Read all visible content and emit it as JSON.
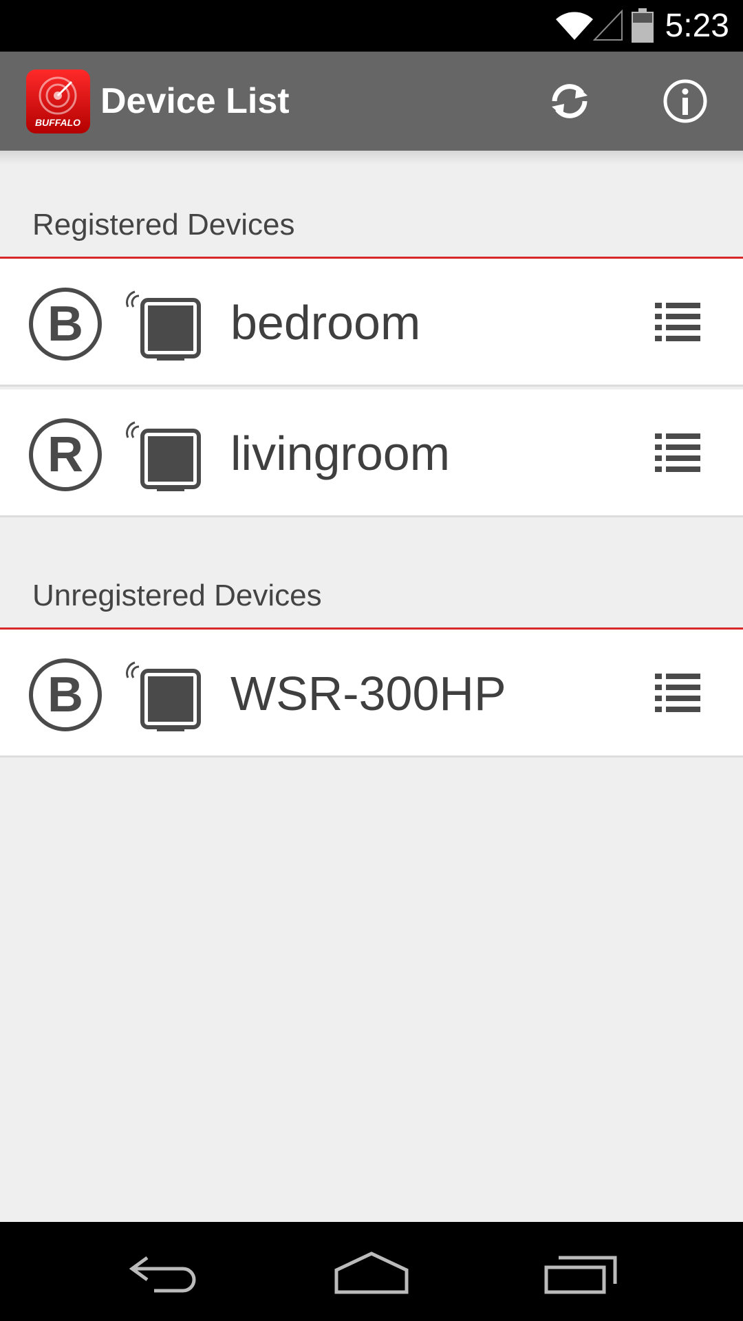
{
  "status_bar": {
    "time": "5:23"
  },
  "app_bar": {
    "title": "Device List",
    "logo_text": "BUFFALO",
    "accent": "#d6282a",
    "bar_color": "#666666"
  },
  "sections": {
    "registered": {
      "label": "Registered Devices",
      "devices": [
        {
          "badge": "B",
          "name": "bedroom"
        },
        {
          "badge": "R",
          "name": "livingroom"
        }
      ]
    },
    "unregistered": {
      "label": "Unregistered Devices",
      "devices": [
        {
          "badge": "B",
          "name": "WSR-300HP"
        }
      ]
    }
  },
  "icons": {
    "refresh": "refresh-icon",
    "info": "info-icon",
    "router": "router-icon",
    "menu": "list-menu-icon",
    "back": "back-icon",
    "home": "home-icon",
    "recents": "recents-icon"
  }
}
